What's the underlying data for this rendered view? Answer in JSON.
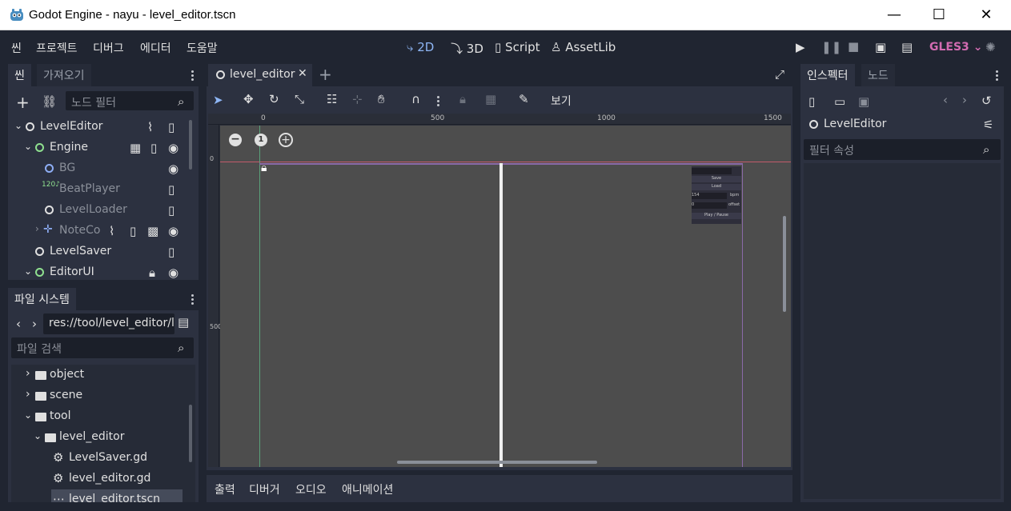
{
  "window": {
    "title": "Godot Engine - nayu - level_editor.tscn",
    "minimize": "—",
    "maximize": "☐",
    "close": "✕"
  },
  "menu": [
    "씬",
    "프로젝트",
    "디버그",
    "에디터",
    "도움말"
  ],
  "workspaces": {
    "w2d": "2D",
    "w3d": "3D",
    "script": "Script",
    "assetlib": "AssetLib"
  },
  "renderer": "GLES3",
  "scene_dock": {
    "tab_scene": "씬",
    "tab_import": "가져오기",
    "filter_placeholder": "노드 필터",
    "nodes": [
      {
        "label": "LevelEditor"
      },
      {
        "label": "Engine"
      },
      {
        "label": "BG"
      },
      {
        "label": "BeatPlayer"
      },
      {
        "label": "LevelLoader"
      },
      {
        "label": "NoteCo"
      },
      {
        "label": "LevelSaver"
      },
      {
        "label": "EditorUI"
      }
    ],
    "beat_badge": "120"
  },
  "filesystem": {
    "tab": "파일 시스템",
    "path": "res://tool/level_editor/l",
    "search_placeholder": "파일 검색",
    "items": [
      {
        "label": "object"
      },
      {
        "label": "scene"
      },
      {
        "label": "tool"
      },
      {
        "label": "level_editor"
      },
      {
        "label": "LevelSaver.gd"
      },
      {
        "label": "level_editor.gd"
      },
      {
        "label": "level_editor.tscn"
      }
    ]
  },
  "editor": {
    "tab": "level_editor",
    "view_menu": "보기",
    "ruler_marks": [
      "0",
      "500",
      "1000",
      "1500"
    ],
    "ruler_v_marks": [
      "0",
      "500"
    ],
    "zoom_reset": "1",
    "mini_ui": {
      "save": "Save",
      "load": "Load",
      "bpm_value": "154",
      "bpm_label": "bpm",
      "offset_value": "0",
      "offset_label": "offset",
      "play": "Play / Pause"
    }
  },
  "bottom_tabs": [
    "출력",
    "디버거",
    "오디오",
    "애니메이션"
  ],
  "inspector": {
    "tab_inspector": "인스펙터",
    "tab_node": "노드",
    "object": "LevelEditor",
    "filter_placeholder": "필터 속성"
  },
  "colors": {
    "accent": "#8eb6f5",
    "gles": "#d26bb1",
    "bg": "#202531",
    "panel": "#2c3140"
  }
}
